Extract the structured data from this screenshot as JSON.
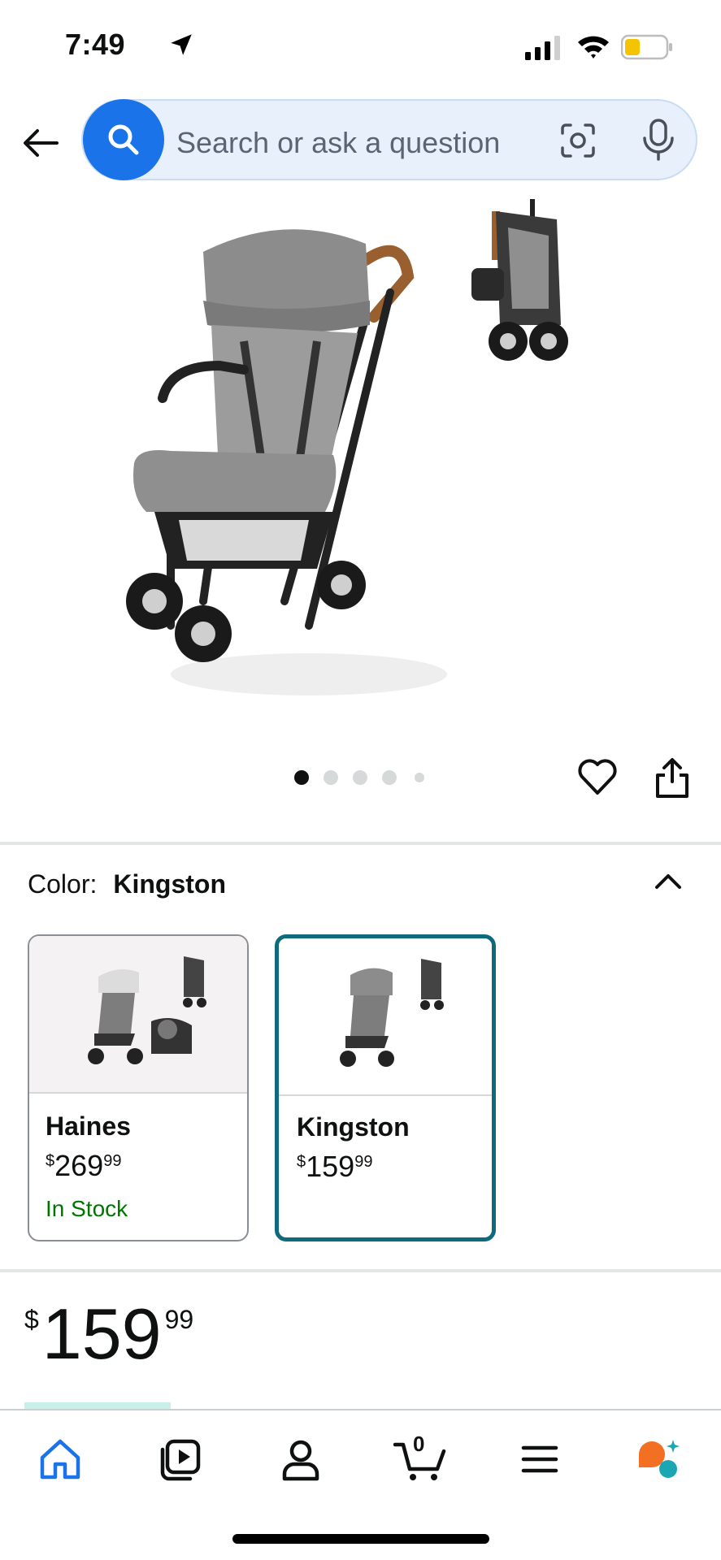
{
  "status_bar": {
    "time": "7:49"
  },
  "search": {
    "placeholder": "Search or ask a question"
  },
  "gallery": {
    "dots_total": 5,
    "active_dot": 1
  },
  "color_section": {
    "label": "Color:",
    "selected_value": "Kingston",
    "options": [
      {
        "name": "Haines",
        "price_symbol": "$",
        "price_whole": "269",
        "price_fraction": "99",
        "stock": "In Stock"
      },
      {
        "name": "Kingston",
        "price_symbol": "$",
        "price_whole": "159",
        "price_fraction": "99",
        "stock": ""
      }
    ]
  },
  "price": {
    "symbol": "$",
    "whole": "159",
    "fraction": "99"
  },
  "bottom_nav": {
    "items": [
      "home-icon",
      "video-icon",
      "account-icon",
      "cart-icon",
      "menu-icon",
      "rufus-icon"
    ],
    "cart_count": "0"
  },
  "colors": {
    "accent": "#1a73e8",
    "selected_border": "#0f6b7c",
    "stock_green": "#007600"
  }
}
